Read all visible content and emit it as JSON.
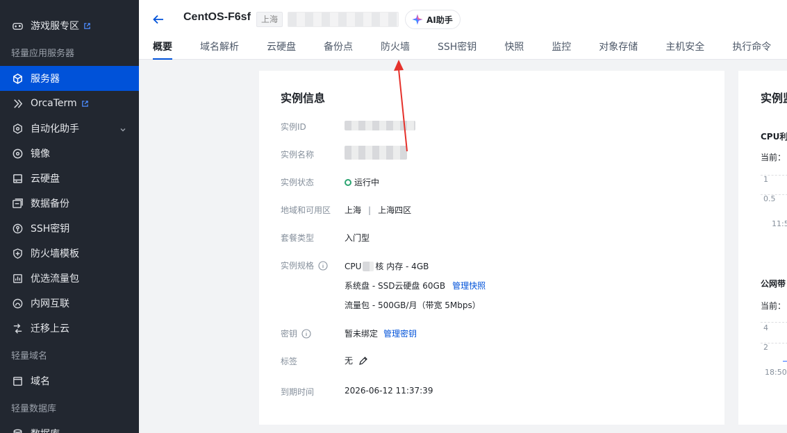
{
  "sidebar": {
    "items": [
      {
        "type": "item",
        "label": "游戏服专区",
        "icon": "gamepad-icon",
        "external": true
      },
      {
        "type": "group",
        "label": "轻量应用服务器"
      },
      {
        "type": "item",
        "label": "服务器",
        "icon": "cube-icon",
        "active": true
      },
      {
        "type": "item",
        "label": "OrcaTerm",
        "icon": "terminal-icon",
        "external": true
      },
      {
        "type": "item",
        "label": "自动化助手",
        "icon": "robot-icon",
        "expandable": true
      },
      {
        "type": "item",
        "label": "镜像",
        "icon": "disc-icon"
      },
      {
        "type": "item",
        "label": "云硬盘",
        "icon": "harddisk-icon"
      },
      {
        "type": "item",
        "label": "数据备份",
        "icon": "backup-icon"
      },
      {
        "type": "item",
        "label": "SSH密钥",
        "icon": "key-icon"
      },
      {
        "type": "item",
        "label": "防火墙模板",
        "icon": "shield-icon"
      },
      {
        "type": "item",
        "label": "优选流量包",
        "icon": "traffic-icon"
      },
      {
        "type": "item",
        "label": "内网互联",
        "icon": "network-icon"
      },
      {
        "type": "item",
        "label": "迁移上云",
        "icon": "migrate-icon"
      },
      {
        "type": "group",
        "label": "轻量域名"
      },
      {
        "type": "item",
        "label": "域名",
        "icon": "domain-icon"
      },
      {
        "type": "group",
        "label": "轻量数据库"
      },
      {
        "type": "item",
        "label": "数据库",
        "icon": "database-icon"
      }
    ]
  },
  "header": {
    "title": "CentOS-F6sf",
    "region_tag": "上海",
    "ai_button": "AI助手"
  },
  "tabs": [
    "概要",
    "域名解析",
    "云硬盘",
    "备份点",
    "防火墙",
    "SSH密钥",
    "快照",
    "监控",
    "对象存储",
    "主机安全",
    "执行命令"
  ],
  "instance": {
    "title": "实例信息",
    "labels": {
      "id": "实例ID",
      "name": "实例名称",
      "status": "实例状态",
      "region": "地域和可用区",
      "package": "套餐类型",
      "spec": "实例规格",
      "key": "密钥",
      "tags": "标签",
      "expire": "到期时间"
    },
    "status": "运行中",
    "region": "上海",
    "zone": "上海四区",
    "package": "入门型",
    "spec_cpu": "CPU",
    "spec_mem": "核 内存 - 4GB",
    "spec_disk": "系统盘 - SSD云硬盘 60GB",
    "spec_disk_link": "管理快照",
    "spec_traffic": "流量包 - 500GB/月（带宽 5Mbps）",
    "key_value": "暂未绑定",
    "key_link": "管理密钥",
    "tags_value": "无",
    "expire": "2026-06-12 11:37:39"
  },
  "monitor": {
    "title": "实例监",
    "cpu_label": "CPU利",
    "current1": "当前：",
    "tick_1": "1",
    "tick_05": "0.5",
    "time1": "11:5",
    "net_label": "公网带",
    "current2": "当前：",
    "tick_4": "4",
    "tick_2": "2",
    "time2": "18:50"
  },
  "colors": {
    "sidebar_bg": "#222730",
    "accent": "#0052d9",
    "running": "#2ba471",
    "annotation_arrow": "#e5312b"
  }
}
